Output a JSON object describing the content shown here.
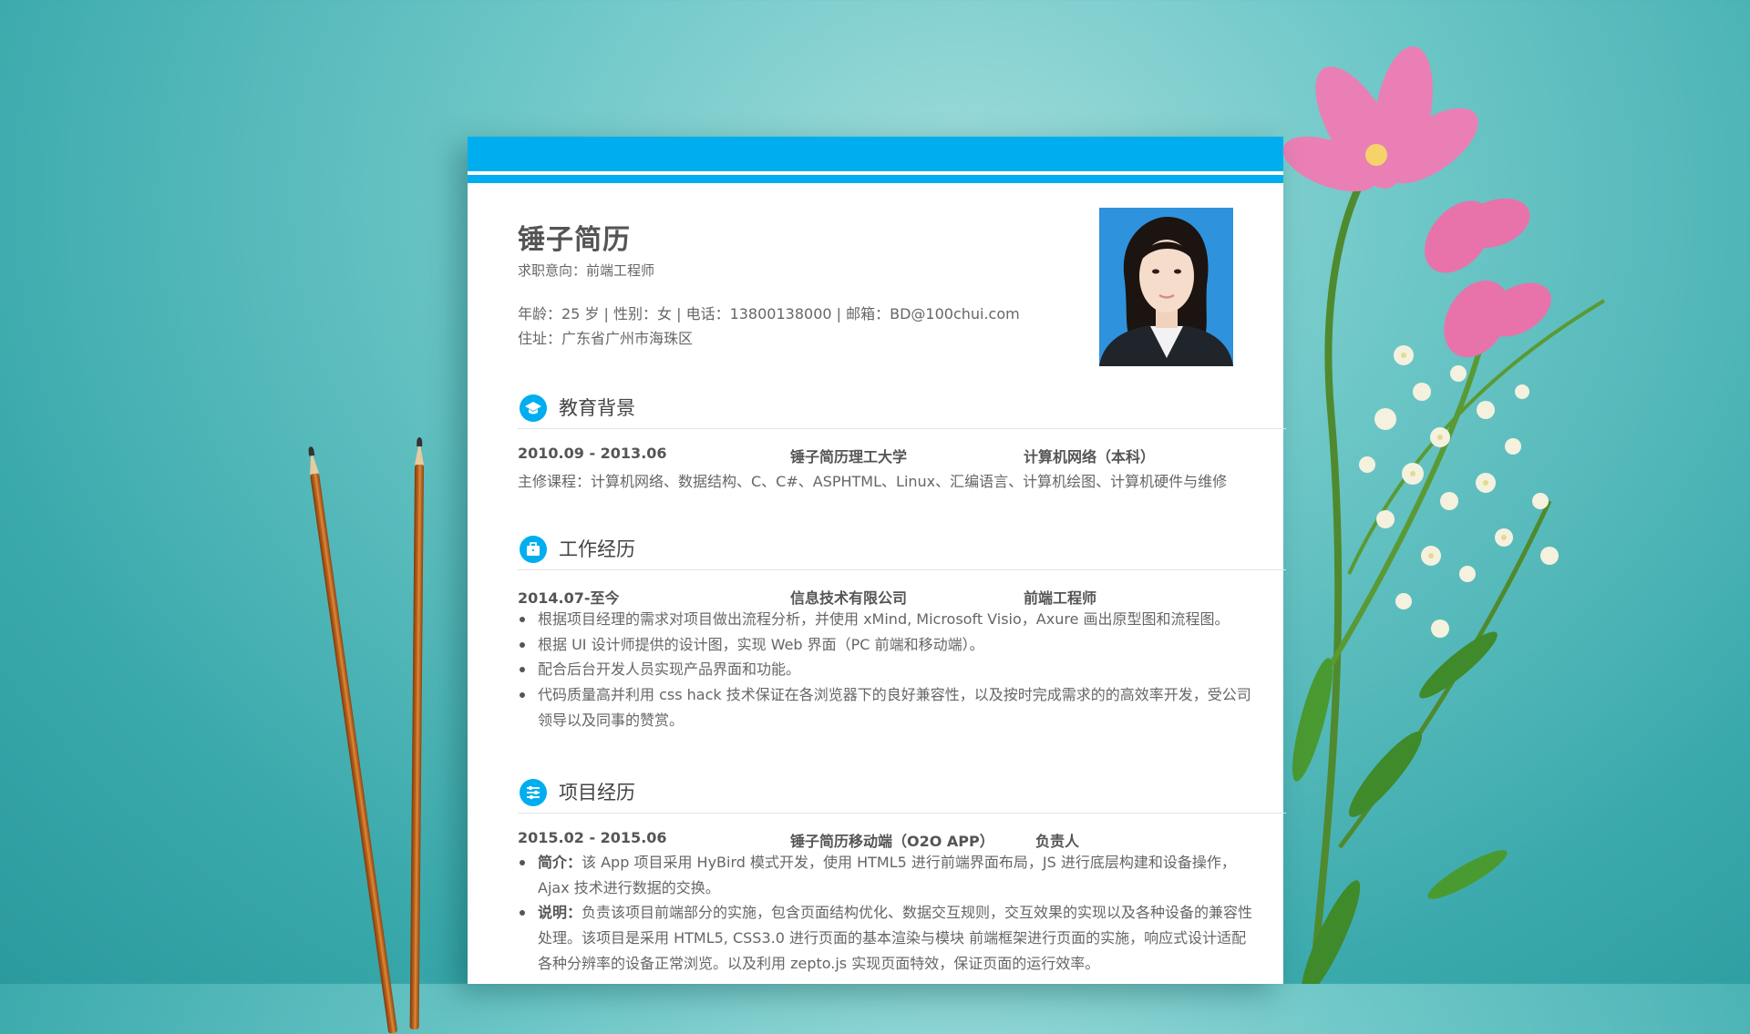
{
  "resume": {
    "name": "锤子简历",
    "job_intent": "求职意向：前端工程师",
    "info_line": "年龄：25 岁 | 性别：女 | 电话：13800138000 | 邮箱：BD@100chui.com",
    "address": "住址：广东省广州市海珠区"
  },
  "education": {
    "title": "教育背景",
    "period": "2010.09 - 2013.06",
    "school": "锤子简历理工大学",
    "major": "计算机网络（本科）",
    "courses": "主修课程：计算机网络、数据结构、C、C#、ASPHTML、Linux、汇编语言、计算机绘图、计算机硬件与维修"
  },
  "work": {
    "title": "工作经历",
    "period": "2014.07-至今",
    "company": "信息技术有限公司",
    "role": "前端工程师",
    "bullets": [
      "根据项目经理的需求对项目做出流程分析，并使用 xMind, Microsoft Visio，Axure  画出原型图和流程图。",
      "根据 UI 设计师提供的设计图，实现 Web 界面（PC 前端和移动端）。",
      "配合后台开发人员实现产品界面和功能。",
      "代码质量高并利用 css hack  技术保证在各浏览器下的良好兼容性，以及按时完成需求的的高效率开发，受公司领导以及同事的赞赏。"
    ]
  },
  "project": {
    "title": "项目经历",
    "period": "2015.02 - 2015.06",
    "name": "锤子简历移动端（O2O APP）",
    "role": "负责人",
    "intro_label": "简介：",
    "intro": "该 App 项目采用 HyBird 模式开发，使用 HTML5 进行前端界面布局，JS 进行底层构建和设备操作，Ajax 技术进行数据的交换。",
    "desc_label": "说明：",
    "desc": "负责该项目前端部分的实施，包含页面结构优化、数据交互规则，交互效果的实现以及各种设备的兼容性处理。该项目是采用 HTML5, CSS3.0 进行页面的基本渲染与模块  前端框架进行页面的实施，响应式设计适配各种分辨率的设备正常浏览。以及利用 zepto.js 实现页面特效，保证页面的运行效率。"
  },
  "colors": {
    "accent": "#00aeef",
    "background": "#4fb9bb"
  },
  "icons": [
    "graduation-cap-icon",
    "briefcase-icon",
    "sliders-icon",
    "pencil-decoration",
    "flower-decoration"
  ]
}
